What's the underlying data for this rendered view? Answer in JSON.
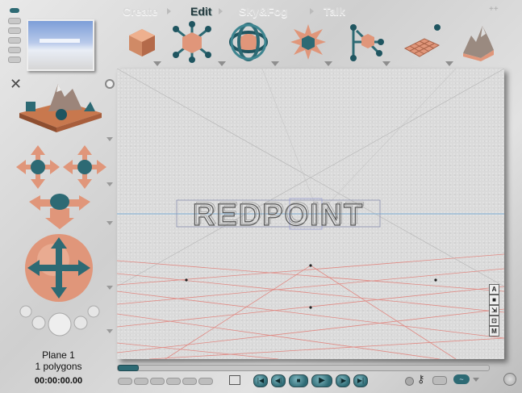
{
  "menu": {
    "items": [
      {
        "label": "Create",
        "active": false
      },
      {
        "label": "Edit",
        "active": true
      },
      {
        "label": "Sky&Fog",
        "active": false
      },
      {
        "label": "Talk",
        "active": false
      }
    ]
  },
  "toolbar": {
    "tools": [
      "object-tool-icon",
      "move-tool-icon",
      "rotate-tool-icon",
      "scale-tool-icon",
      "link-tool-icon",
      "tile-tool-icon",
      "terrain-tool-icon"
    ]
  },
  "viewport": {
    "text_object": "REDPOINT",
    "side_buttons": [
      "A",
      "■",
      "⇲",
      "⊡",
      "M"
    ]
  },
  "status": {
    "object_name": "Plane 1",
    "polygon_count": "1 polygons",
    "time": "00:00:00.00"
  },
  "colors": {
    "accent_teal": "#2d6a74",
    "accent_salmon": "#e0967a",
    "grid_line": "#e08a84",
    "horizon": "#7fb0d8"
  }
}
